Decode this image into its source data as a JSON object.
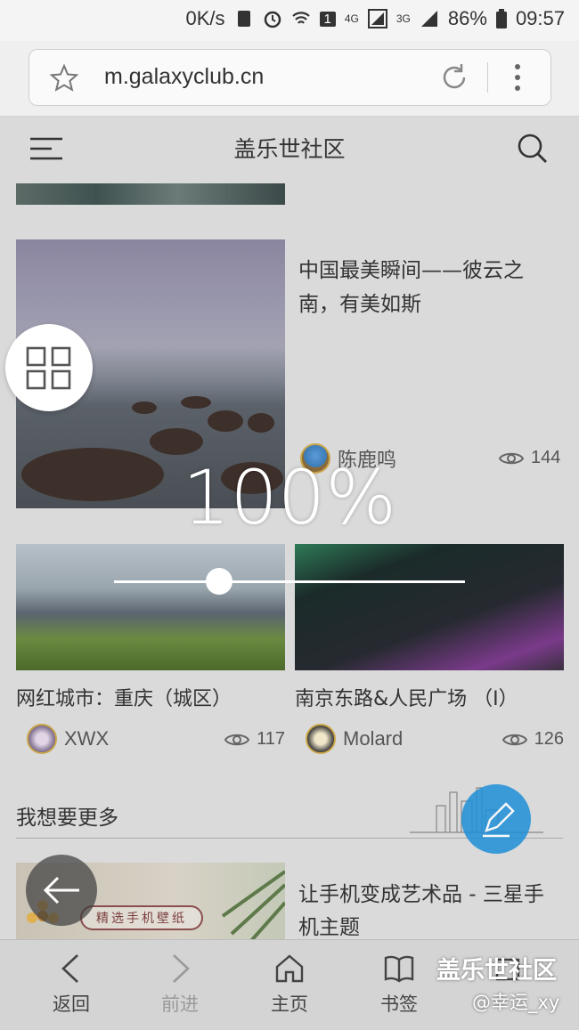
{
  "status_bar": {
    "speed": "0K/s",
    "sim_badge": "1",
    "network_4g": "4G",
    "network_3g": "3G",
    "battery": "86%",
    "time": "09:57"
  },
  "browser": {
    "url": "m.galaxyclub.cn"
  },
  "site": {
    "title": "盖乐世社区"
  },
  "featured": {
    "title": "中国最美瞬间——彼云之南，有美如斯",
    "author": "陈鹿鸣",
    "views": "144"
  },
  "cards": [
    {
      "title": "网红城市：重庆（城区）",
      "author": "XWX",
      "views": "117"
    },
    {
      "title": "南京东路&人民广场 （I）",
      "author": "Molard",
      "views": "126"
    }
  ],
  "section": {
    "heading": "我想要更多"
  },
  "wallpaper_post": {
    "badge": "精选手机壁纸",
    "title": "让手机变成艺术品 - 三星手机主题"
  },
  "zoom": {
    "label": "100%",
    "level": 0.3
  },
  "bottom_nav": {
    "back": "返回",
    "forward": "前进",
    "home": "主页",
    "bookmarks": "书签"
  },
  "watermark": {
    "brand": "盖乐世社区",
    "user": "@幸运_xy"
  }
}
